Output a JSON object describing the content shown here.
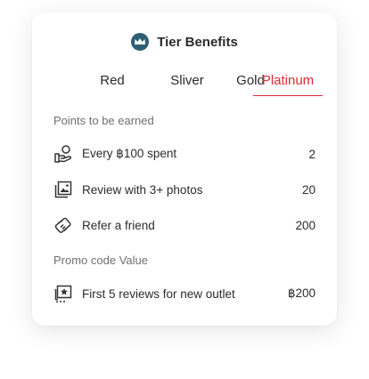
{
  "header": {
    "title": "Tier Benefits",
    "icon": "crown-badge-icon",
    "badge_color": "#2f5f73"
  },
  "tabs": [
    {
      "label": "Red"
    },
    {
      "label": "Sliver"
    },
    {
      "label": "Gold"
    },
    {
      "label": "Platinum",
      "active": true
    }
  ],
  "accent_color": "#e12a36",
  "points_section": {
    "title": "Points to be earned",
    "items": [
      {
        "icon": "hand-coin-icon",
        "label": "Every ฿100 spent",
        "value": "2"
      },
      {
        "icon": "photos-icon",
        "label": "Review with 3+ photos",
        "value": "20"
      },
      {
        "icon": "handshake-icon",
        "label": "Refer a friend",
        "value": "200"
      }
    ]
  },
  "promo_section": {
    "title": "Promo code Value",
    "items": [
      {
        "icon": "star-review-icon",
        "label": "First 5 reviews for new outlet",
        "value": "฿200"
      }
    ]
  }
}
